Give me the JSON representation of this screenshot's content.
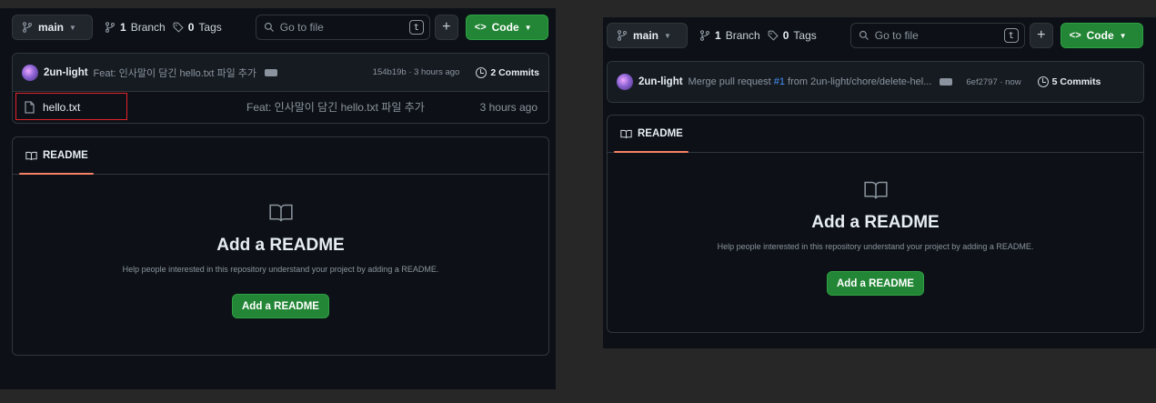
{
  "left": {
    "branch_button": {
      "label": "main"
    },
    "branches": {
      "count": "1",
      "label": "Branch"
    },
    "tags": {
      "count": "0",
      "label": "Tags"
    },
    "search": {
      "placeholder": "Go to file",
      "shortcut": "t"
    },
    "add_button": {
      "label": "+"
    },
    "code_button": {
      "label": "Code"
    },
    "commit": {
      "author": "2un-light",
      "message": "Feat: 인사말이 담긴 hello.txt 파일 추가",
      "sha_time": "154b19b · 3 hours ago",
      "commits_count": "2 Commits"
    },
    "files": [
      {
        "name": "hello.txt",
        "message": "Feat: 인사말이 담긴 hello.txt 파일 추가",
        "time": "3 hours ago"
      }
    ],
    "readme": {
      "tab": "README",
      "heading": "Add a README",
      "description": "Help people interested in this repository understand your project by adding a README.",
      "button": "Add a README"
    }
  },
  "right": {
    "branch_button": {
      "label": "main"
    },
    "branches": {
      "count": "1",
      "label": "Branch"
    },
    "tags": {
      "count": "0",
      "label": "Tags"
    },
    "search": {
      "placeholder": "Go to file",
      "shortcut": "t"
    },
    "add_button": {
      "label": "+"
    },
    "code_button": {
      "label": "Code"
    },
    "commit": {
      "author": "2un-light",
      "message_pre": "Merge pull request ",
      "pr_ref": "#1",
      "message_post": " from 2un-light/chore/delete-hel...",
      "sha_time": "6ef2797 · now",
      "commits_count": "5 Commits"
    },
    "readme": {
      "tab": "README",
      "heading": "Add a README",
      "description": "Help people interested in this repository understand your project by adding a README.",
      "button": "Add a README"
    }
  },
  "colors": {
    "background": "#272727",
    "panel": "#0d1117",
    "border": "#30363d",
    "green": "#238636",
    "accent_underline": "#f78166",
    "highlight": "#e0242a",
    "link": "#4493f8"
  }
}
